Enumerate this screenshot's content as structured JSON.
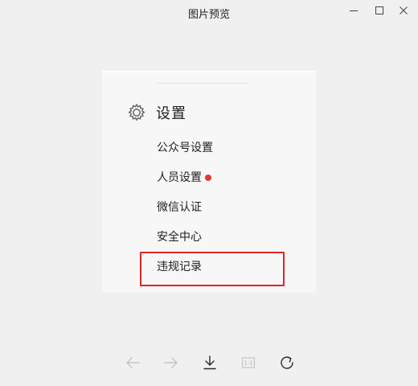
{
  "window": {
    "title": "图片预览",
    "controls": [
      "minimize",
      "maximize",
      "close"
    ]
  },
  "preview": {
    "settings_header": {
      "icon": "gear-icon",
      "label": "设置"
    },
    "menu_items": [
      {
        "label": "公众号设置",
        "badge": false
      },
      {
        "label": "人员设置",
        "badge": true
      },
      {
        "label": "微信认证",
        "badge": false
      },
      {
        "label": "安全中心",
        "badge": false
      },
      {
        "label": "违规记录",
        "badge": false,
        "highlighted": true
      }
    ],
    "badge_color": "#e53935",
    "highlight_color": "#e02424"
  },
  "toolbar": {
    "tools": [
      {
        "name": "previous",
        "icon": "arrow-left-icon",
        "enabled": false
      },
      {
        "name": "next",
        "icon": "arrow-right-icon",
        "enabled": false
      },
      {
        "name": "download",
        "icon": "download-icon",
        "enabled": true
      },
      {
        "name": "actual-size",
        "icon": "actual-size-icon",
        "text": "1:1",
        "enabled": false
      },
      {
        "name": "rotate",
        "icon": "rotate-icon",
        "enabled": true
      }
    ]
  }
}
